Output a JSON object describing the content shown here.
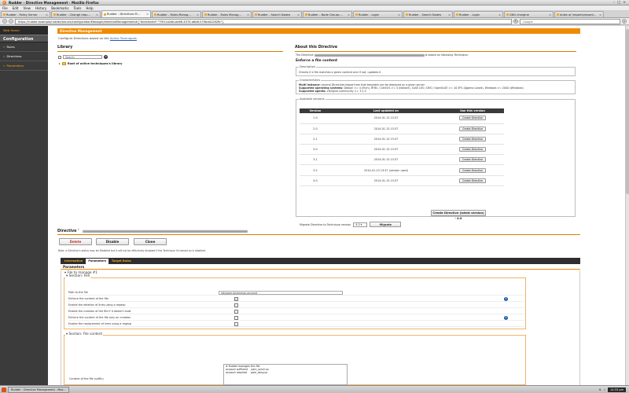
{
  "window": {
    "title": "Rudder - Directive Management - Mozilla Firefox"
  },
  "menubar": [
    "File",
    "Edit",
    "View",
    "History",
    "Bookmarks",
    "Tools",
    "Help"
  ],
  "tabs": [
    {
      "label": "Rudder - Policy Server",
      "active": false
    },
    {
      "label": "Rudder - Change requ...",
      "active": false
    },
    {
      "label": "Rudder - Directives M...",
      "active": true
    },
    {
      "label": "Rudder - Rules Manag...",
      "active": false
    },
    {
      "label": "Rudder - Rules Manag...",
      "active": false
    },
    {
      "label": "Rudder - Search Nodes",
      "active": false
    },
    {
      "label": "Rudder - Node Groups ...",
      "active": false
    },
    {
      "label": "Rudder - Login",
      "active": false
    },
    {
      "label": "Rudder - Search Nodes",
      "active": false
    },
    {
      "label": "Rudder - Login",
      "active": false
    },
    {
      "label": "GNU chargine",
      "active": false
    },
    {
      "label": "Index of /reports/reporti...",
      "active": false
    }
  ],
  "navbar": {
    "url": "https://rudder.example/rudder/secure/configurationManager/directiveManagement#{\"directiveId\":\"7f911a2db-be66-4374-a6d6-070bdd1282fb\"}",
    "search_placeholder": "Google"
  },
  "sidebar": {
    "brand": "Web Home",
    "section": "Configuration",
    "items": [
      {
        "label": "Rules",
        "selected": false
      },
      {
        "label": "Directives",
        "selected": false
      },
      {
        "label": "Parameters",
        "selected": true
      }
    ]
  },
  "page": {
    "header": "Directive Management",
    "subtitle_prefix": "Configure Directives based on the",
    "subtitle_link": "Active Techniques"
  },
  "library": {
    "title": "Library",
    "search_placeholder": "Search",
    "tree_root": "Root of active techniques's library"
  },
  "about": {
    "title": "About this Directive",
    "desc_prefix": "The Directive",
    "desc_suffix": "is based on following Technique:",
    "technique_name": "Enforce a file content",
    "description_legend": "Description",
    "description_text": "Checks if a file matches a given content and if not, updates it",
    "characteristics_legend": "Characteristics",
    "char_multi_label": "Multi instance:",
    "char_multi_text": "several Directives based from that template can be deployed on a given server",
    "char_os_label": "Supported operating systems:",
    "char_os_text": "Debian >= 4 (Etch), RHEL / CentOS >= 4 (Nahant), SuSE LES / DES / OpenSuSE >= 10 SP1 (Agama Lizard), Windows >= 2000 (Windows)",
    "char_agents_label": "Supported agents:",
    "char_agents_text": "cfengine-community >= 3.1.5"
  },
  "versions": {
    "legend": "Available versions",
    "headers": [
      "Version",
      "Last updated on",
      "Use this version"
    ],
    "rows": [
      {
        "version": "1.0",
        "updated": "2014-01-13 13:37",
        "button": "Create Directive"
      },
      {
        "version": "2.0",
        "updated": "2014-01-13 13:37",
        "button": "Create Directive"
      },
      {
        "version": "2.1",
        "updated": "2014-01-13 13:37",
        "button": "Create Directive"
      },
      {
        "version": "3.0",
        "updated": "2014-01-13 13:37",
        "button": "Create Directive"
      },
      {
        "version": "3.1",
        "updated": "2014-01-13 13:37",
        "button": "Create Directive"
      },
      {
        "version": "3.2",
        "updated": "2014-01-13 13:37 (version used)",
        "button": "Create Directive"
      },
      {
        "version": "4.0",
        "updated": "2014-01-13 13:37",
        "button": "Create Directive"
      }
    ],
    "latest_button": "Create Directive (latest version) - 4.0",
    "migrate_label": "Migrate Directive to Technique version",
    "migrate_value": "4.0",
    "migrate_button": "Migrate"
  },
  "directive": {
    "title": "Directive '",
    "delete": "Delete",
    "disable": "Disable",
    "clone": "Clone",
    "note": "Note: a Directive's status may be Disabled but it will not be effectively disabled if the Technique it's based on is disabled."
  },
  "ptabs": [
    "Information",
    "Parameters",
    "Target Rules"
  ],
  "params": {
    "header": "Parameters",
    "group_title": "File to manage #1",
    "section_file": "Section: File",
    "rows": [
      {
        "label": "Path to the file",
        "kind": "input",
        "value": "/etc/pam.d/common-account"
      },
      {
        "label": "Enforce the content of the file",
        "kind": "check",
        "checked": true,
        "info": true
      },
      {
        "label": "Enable the deletion of lines using a regexp",
        "kind": "check",
        "checked": false,
        "info": false
      },
      {
        "label": "Enable the creation of the file if it doesn't exist",
        "kind": "check",
        "checked": false,
        "info": false
      },
      {
        "label": "Enforce the content of the file only on creation",
        "kind": "check",
        "checked": false,
        "info": true
      },
      {
        "label": "Enable the replacement of lines using a regexp",
        "kind": "check",
        "checked": false,
        "info": false
      }
    ],
    "section_content": "Section: File content",
    "content_label": "Content of the file (suffix)",
    "content_value": "# Rudder manages this file\naccount sufficient    pam_unix2.so\naccount required     pam_deny.so"
  },
  "taskbar": {
    "task": "Rudder - Directive Management - Moz...",
    "clock": "14:33 pm"
  },
  "colors": {
    "accent": "#f08a00",
    "sidebar": "#3b3b3b",
    "link": "#2b5aa8"
  }
}
